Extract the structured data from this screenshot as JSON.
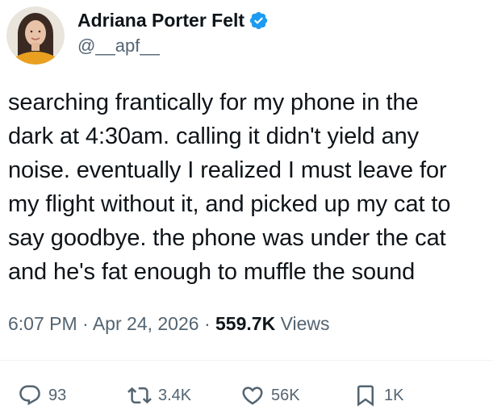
{
  "author": {
    "display_name": "Adriana Porter Felt",
    "handle": "@__apf__",
    "verified": true,
    "verified_color": "#1d9bf0",
    "avatar_icon": "avatar-photo"
  },
  "tweet": {
    "lines": [
      "searching frantically for my phone in the",
      "dark at 4:30am. calling it didn't yield any",
      "noise. eventually I realized I must leave for",
      "my flight without it, and picked up my cat to",
      "say goodbye. the phone was under the cat",
      "and he's fat enough to muffle the sound"
    ]
  },
  "meta": {
    "time": "6:07 PM",
    "separator": "·",
    "date": "Apr 24, 2026",
    "views_count": "559.7K",
    "views_label": "Views"
  },
  "actions": {
    "replies": {
      "icon": "reply-icon",
      "count": "93"
    },
    "retweets": {
      "icon": "retweet-icon",
      "count": "3.4K"
    },
    "likes": {
      "icon": "heart-icon",
      "count": "56K"
    },
    "bookmarks": {
      "icon": "bookmark-icon",
      "count": "1K"
    }
  },
  "colors": {
    "text_primary": "#0f1419",
    "text_secondary": "#536471",
    "accent": "#1d9bf0"
  }
}
